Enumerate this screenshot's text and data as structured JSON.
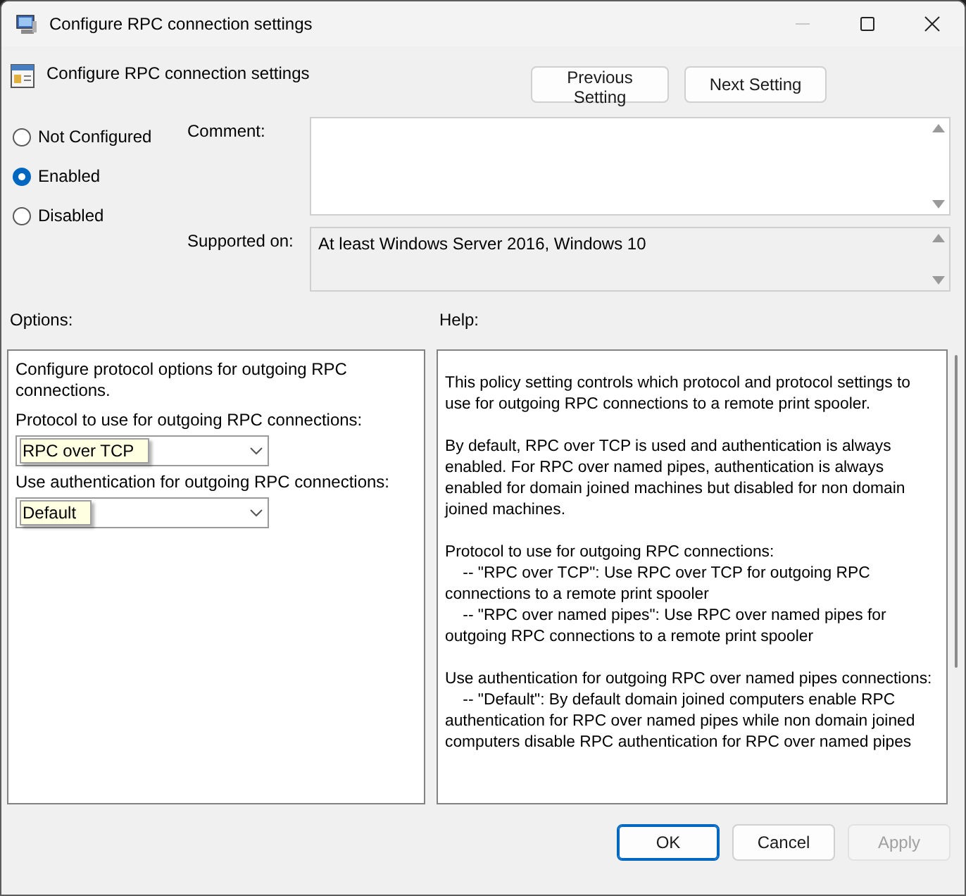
{
  "window": {
    "title": "Configure RPC connection settings"
  },
  "policy": {
    "name": "Configure RPC connection settings"
  },
  "nav_buttons": [
    {
      "label": "Previous Setting"
    },
    {
      "label": "Next Setting"
    }
  ],
  "state_options": [
    {
      "label": "Not Configured",
      "selected": false
    },
    {
      "label": "Enabled",
      "selected": true
    },
    {
      "label": "Disabled",
      "selected": false
    }
  ],
  "comment": {
    "label": "Comment:"
  },
  "supported_on": {
    "label": "Supported on:",
    "value": "At least Windows Server 2016, Windows 10"
  },
  "options": {
    "label": "Options:",
    "description": "Configure protocol options for outgoing RPC connections.",
    "fields": [
      {
        "label": "Protocol to use for outgoing RPC connections:",
        "value": "RPC over TCP"
      },
      {
        "label": "Use authentication for outgoing RPC connections:",
        "value": "Default"
      }
    ]
  },
  "help": {
    "label": "Help:",
    "paragraphs": [
      "This policy setting controls which protocol and protocol settings to use for outgoing RPC connections to a remote print spooler.",
      "By default, RPC over TCP is used and authentication is always enabled. For RPC over named pipes, authentication is always enabled for domain joined machines but disabled for non domain joined machines.",
      "Protocol to use for outgoing RPC connections:\n    -- \"RPC over TCP\": Use RPC over TCP for outgoing RPC connections to a remote print spooler\n    -- \"RPC over named pipes\": Use RPC over named pipes for outgoing RPC connections to a remote print spooler",
      "Use authentication for outgoing RPC over named pipes connections:\n    -- \"Default\": By default domain joined computers enable RPC authentication for RPC over named pipes while non domain joined computers disable RPC authentication for RPC over named pipes"
    ]
  },
  "buttons": [
    {
      "label": "OK",
      "default": true,
      "disabled": false
    },
    {
      "label": "Cancel",
      "default": false,
      "disabled": false
    },
    {
      "label": "Apply",
      "default": false,
      "disabled": true
    }
  ]
}
